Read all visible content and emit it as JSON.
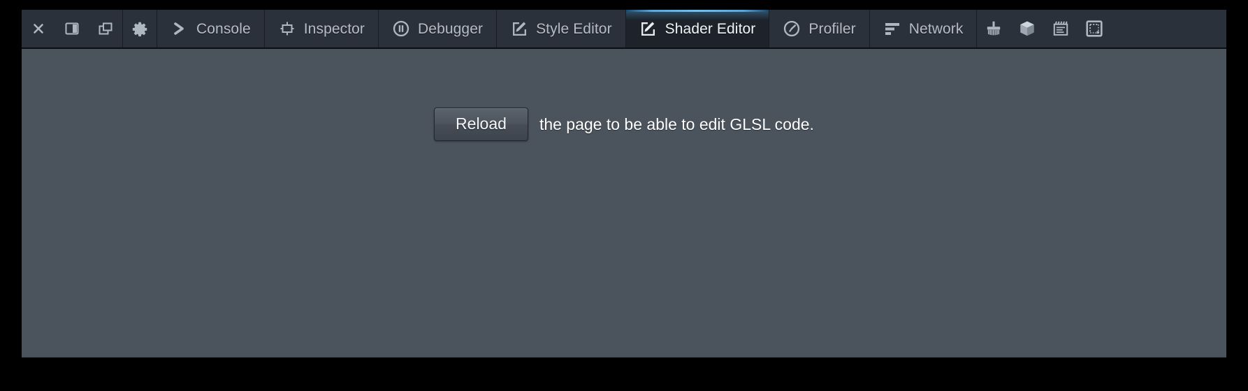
{
  "window": {
    "title": "Firefox Developer Tools",
    "frame_background": "#000000",
    "toolbar_background": "#2b313b",
    "content_background": "#4b535c",
    "accent_color": "#53a9e0"
  },
  "toolbar": {
    "left_controls": [
      {
        "name": "close-devtools-button",
        "icon": "close-icon",
        "title": "Close Developer Tools"
      },
      {
        "name": "dock-to-side-button",
        "icon": "dock-side-icon",
        "title": "Dock to Side"
      },
      {
        "name": "separate-window-button",
        "icon": "separate-window-icon",
        "title": "Separate Window"
      }
    ],
    "settings_button": {
      "name": "settings-button",
      "icon": "gear-icon",
      "title": "Settings"
    },
    "tabs": [
      {
        "id": "console",
        "label": "Console",
        "icon": "chevron-right-icon",
        "selected": false
      },
      {
        "id": "inspector",
        "label": "Inspector",
        "icon": "inspector-box-icon",
        "selected": false
      },
      {
        "id": "debugger",
        "label": "Debugger",
        "icon": "pause-circle-icon",
        "selected": false
      },
      {
        "id": "style-editor",
        "label": "Style Editor",
        "icon": "pencil-box-icon",
        "selected": false
      },
      {
        "id": "shader-editor",
        "label": "Shader Editor",
        "icon": "pencil-box-icon",
        "selected": true
      },
      {
        "id": "profiler",
        "label": "Profiler",
        "icon": "stopwatch-icon",
        "selected": false
      },
      {
        "id": "network",
        "label": "Network",
        "icon": "network-bars-icon",
        "selected": false
      }
    ],
    "right_controls": [
      {
        "name": "paint-tool-button",
        "icon": "paintbrush-icon",
        "title": "Paint Flashing"
      },
      {
        "name": "scratchpad-3d-button",
        "icon": "cube-icon",
        "title": "3D View"
      },
      {
        "name": "animation-button",
        "icon": "clapperboard-icon",
        "title": "Animations"
      },
      {
        "name": "responsive-design-button",
        "icon": "responsive-design-icon",
        "title": "Responsive Design Mode"
      }
    ]
  },
  "main": {
    "reload_button_label": "Reload",
    "notice_text": "the page to be able to edit GLSL code."
  }
}
